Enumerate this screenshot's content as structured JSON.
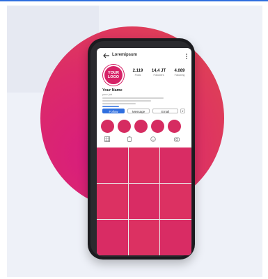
{
  "profile": {
    "username": "Loremipsum",
    "logo_line1": "YOUR",
    "logo_line2": "LOGO",
    "name": "Your Name",
    "handle": "your job",
    "stats": [
      {
        "value": "2.119",
        "label": "Posts"
      },
      {
        "value": "14,4 JT",
        "label": "Followers"
      },
      {
        "value": "4.089",
        "label": "Following"
      }
    ]
  },
  "buttons": {
    "follow": "Follow",
    "message": "Message",
    "email": "Email"
  },
  "colors": {
    "brand": "#d62166",
    "accent_blue": "#2f6fdf"
  },
  "icons": [
    "back-arrow-icon",
    "more-icon",
    "grid-icon",
    "tagged-icon",
    "emoji-icon",
    "camera-icon"
  ]
}
